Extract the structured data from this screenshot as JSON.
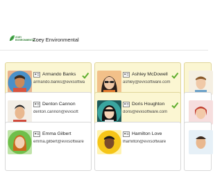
{
  "header": {
    "logo_text_line1": "ZOEY",
    "logo_text_line2": "ENVIRONMENTAL",
    "company_name": "Zoey Environmental"
  },
  "colors": {
    "selected_card": "#fbf6d2",
    "check": "#5fae2e",
    "brand_green": "#2e7d32"
  },
  "contacts": [
    {
      "name": "Armando Banks",
      "email": "armando.banks@evxsoftwa",
      "selected": true,
      "checked": true,
      "icon": "contact-card-icon"
    },
    {
      "name": "Ashley McDowell",
      "email": "ashley@evxsoftware.com",
      "selected": true,
      "checked": true,
      "icon": "contact-card-icon"
    },
    {
      "name": "",
      "email": "",
      "selected": true,
      "checked": false
    },
    {
      "name": "Denton Cannon",
      "email": "denton.cannon@evxsoft",
      "selected": false,
      "checked": false,
      "icon": "contact-card-icon"
    },
    {
      "name": "Doris Houghton",
      "email": "doris@evxsoftware.com",
      "selected": true,
      "checked": true,
      "icon": "contact-card-icon"
    },
    {
      "name": "",
      "email": "",
      "selected": false,
      "checked": false
    },
    {
      "name": "Emma Gilbert",
      "email": "emma.gilbert@evxsoftware",
      "selected": false,
      "checked": false,
      "icon": "contact-card-icon"
    },
    {
      "name": "Hamilton Love",
      "email": "lhamilton@evxsoftware",
      "selected": false,
      "checked": false,
      "icon": "contact-card-icon"
    },
    {
      "name": "",
      "email": "",
      "selected": false,
      "checked": false
    }
  ]
}
